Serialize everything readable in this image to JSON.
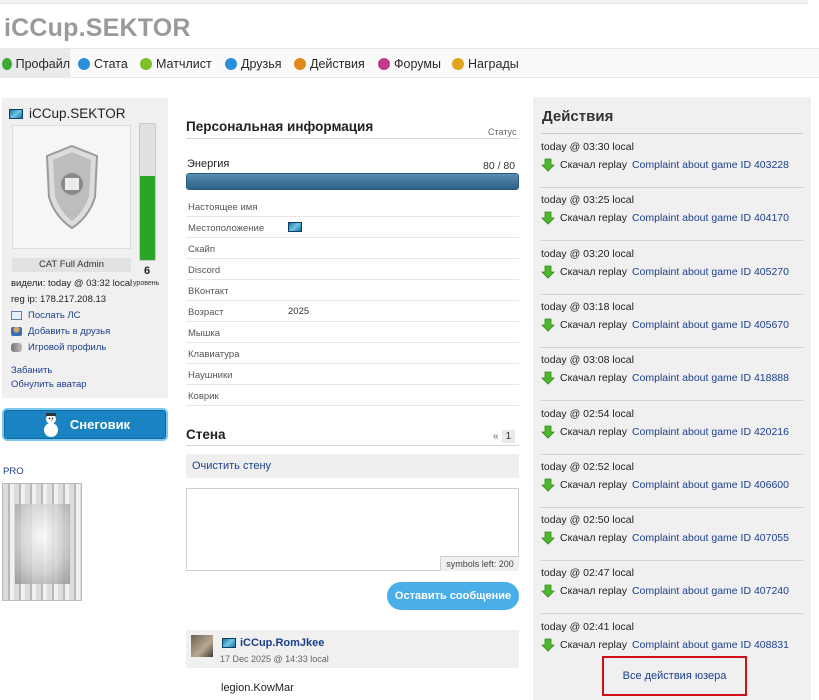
{
  "site": {
    "title": "iCCup.SEKTOR"
  },
  "tabs": [
    {
      "label": "Профайл",
      "icon": "profile-icon",
      "color": "#3aa935"
    },
    {
      "label": "Стата",
      "icon": "stats-icon",
      "color": "#2a8fd8"
    },
    {
      "label": "Матчлист",
      "icon": "matchlist-icon",
      "color": "#7fbf2a"
    },
    {
      "label": "Друзья",
      "icon": "friends-icon",
      "color": "#2a8fd8"
    },
    {
      "label": "Действия",
      "icon": "actions-icon",
      "color": "#e08a1e"
    },
    {
      "label": "Форумы",
      "icon": "forums-icon",
      "color": "#c23b8a"
    },
    {
      "label": "Награды",
      "icon": "awards-icon",
      "color": "#e0a51e"
    }
  ],
  "profile": {
    "nick": "iCCup.SEKTOR",
    "badge": "CAT Full Admin",
    "level": "6",
    "level_label": "уровень",
    "level_progress": 0.62,
    "seen": "видели: today @ 03:32 local",
    "reg_ip": "reg ip: 178.217.208.13",
    "actions": [
      "Послать ЛС",
      "Добавить в друзья",
      "Игровой профиль"
    ],
    "ban": "Забанить",
    "reset_avatar": "Обнулить аватар",
    "snow_button": "Снеговик",
    "pro_label": "PRO"
  },
  "personal": {
    "title": "Персональная информация",
    "status_label": "Статус",
    "energy_label": "Энергия",
    "energy_value": "80 / 80",
    "energy_fraction": 1.0,
    "rows": [
      {
        "key": "Настоящее имя",
        "value": ""
      },
      {
        "key": "Местоположение",
        "value": ""
      },
      {
        "key": "Скайп",
        "value": ""
      },
      {
        "key": "Discord",
        "value": ""
      },
      {
        "key": "ВКонтакт",
        "value": ""
      },
      {
        "key": "Возраст",
        "value": "2025"
      },
      {
        "key": "Мышка",
        "value": ""
      },
      {
        "key": "Клавиатура",
        "value": ""
      },
      {
        "key": "Наушники",
        "value": ""
      },
      {
        "key": "Коврик",
        "value": ""
      }
    ]
  },
  "wall": {
    "title": "Стена",
    "pager_prev": "«",
    "pager_page": "1",
    "clear": "Очистить стену",
    "input_value": "",
    "symbols_left": "symbols left: 200",
    "post_button": "Оставить сообщение",
    "post": {
      "author": "iCCup.RomJkee",
      "date": "17 Dec 2025 @ 14:33 local",
      "text": "legion.KowMar"
    }
  },
  "actions": {
    "title": "Действия",
    "verb": "Скачал replay",
    "items": [
      {
        "time": "today @ 03:30 local",
        "link": "Complaint about game ID 403228"
      },
      {
        "time": "today @ 03:25 local",
        "link": "Complaint about game ID 404170"
      },
      {
        "time": "today @ 03:20 local",
        "link": "Complaint about game ID 405270"
      },
      {
        "time": "today @ 03:18 local",
        "link": "Complaint about game ID 405670"
      },
      {
        "time": "today @ 03:08 local",
        "link": "Complaint about game ID 418888"
      },
      {
        "time": "today @ 02:54 local",
        "link": "Complaint about game ID 420216"
      },
      {
        "time": "today @ 02:52 local",
        "link": "Complaint about game ID 406600"
      },
      {
        "time": "today @ 02:50 local",
        "link": "Complaint about game ID 407055"
      },
      {
        "time": "today @ 02:47 local",
        "link": "Complaint about game ID 407240"
      },
      {
        "time": "today @ 02:41 local",
        "link": "Complaint about game ID 408831"
      }
    ],
    "all_link": "Все действия юзера"
  }
}
